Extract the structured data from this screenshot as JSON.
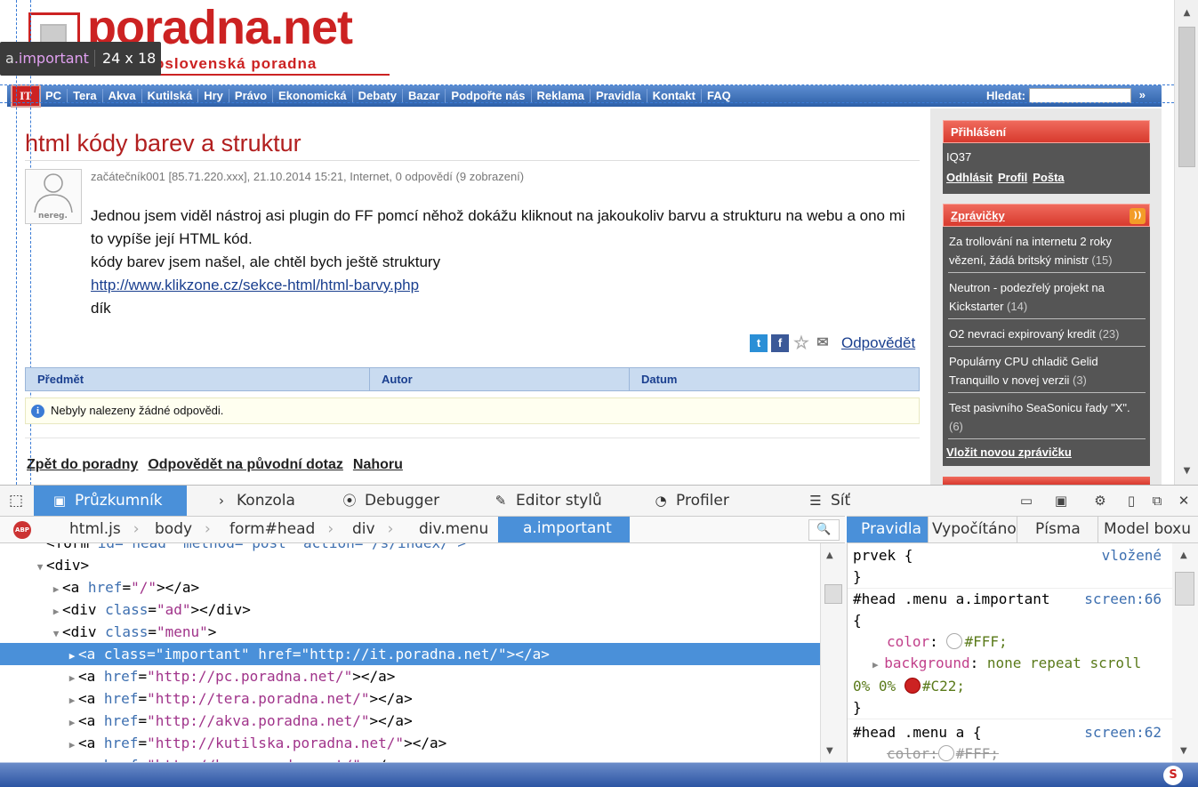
{
  "site": {
    "logo_text": "poradna.net",
    "logo_sub": "oslovenská poradna",
    "inspector_tooltip": {
      "selector_tag": "a",
      "selector_class": ".important",
      "dimensions": "24 x 18"
    }
  },
  "menu": {
    "it_label": "IT",
    "items": [
      "PC",
      "Tera",
      "Akva",
      "Kutilská",
      "Hry",
      "Právo",
      "Ekonomická",
      "Debaty",
      "Bazar",
      "Podpořte nás",
      "Reklama",
      "Pravidla",
      "Kontakt",
      "FAQ"
    ],
    "search_label": "Hledat:",
    "search_value": "",
    "search_go": "»"
  },
  "question": {
    "title": "html kódy barev a struktur",
    "avatar_label": "nereg.",
    "meta": "začátečník001 [85.71.220.xxx], 21.10.2014 15:21, Internet, 0 odpovědí (9 zobrazení)",
    "body_lines": [
      "Jednou jsem viděl nástroj asi plugin do FF pomcí něhož dokážu kliknout na jakoukoliv barvu a strukturu na webu a ono mi to vypíše její HTML kód.",
      "kódy barev jsem našel, ale chtěl bych ještě struktury"
    ],
    "link": "http://www.klikzone.cz/sekce-html/html-barvy.php",
    "thanks": "dík",
    "reply_link": "Odpovědět"
  },
  "replies_table": {
    "columns": [
      "Předmět",
      "Autor",
      "Datum"
    ],
    "empty_message": "Nebyly nalezeny žádné odpovědi."
  },
  "bottom_links": [
    "Zpět do poradny",
    "Odpovědět na původní dotaz",
    "Nahoru"
  ],
  "sidebar": {
    "login": {
      "title": "Přihlášení",
      "user": "IQ37",
      "links": [
        "Odhlásit",
        "Profil",
        "Pošta"
      ]
    },
    "news": {
      "title": "Zprávičky",
      "items": [
        {
          "text": "Za trollování na internetu 2 roky vězení, žádá britský ministr",
          "count": "(15)"
        },
        {
          "text": "Neutron - podezřelý projekt na Kickstarter",
          "count": "(14)"
        },
        {
          "text": "O2 nevraci expirovaný kredit",
          "count": "(23)"
        },
        {
          "text": "Populárny CPU chladič Gelid Tranquillo v novej verzii",
          "count": "(3)"
        },
        {
          "text": "Test pasivního SeaSonicu řady \"X\".",
          "count": "(6)"
        }
      ],
      "add_link": "Vložit novou zprávičku"
    }
  },
  "devtools": {
    "tabs": [
      "Průzkumník",
      "Konzola",
      "Debugger",
      "Editor stylů",
      "Profiler",
      "Síť"
    ],
    "active_tab": "Průzkumník",
    "breadcrumbs": [
      "html.js",
      "body",
      "form#head",
      "div",
      "div.menu",
      "a.important"
    ],
    "markup_lines": [
      {
        "indent": 3,
        "open": "<form ",
        "rest": "id=\"head\" method=\"post\" action=\"/s/index/\">",
        "twisty": ""
      },
      {
        "indent": 3,
        "twisty": "▼",
        "html": "<div>"
      },
      {
        "indent": 4,
        "twisty": "▶",
        "tag": "a",
        "attrs": [
          [
            "href",
            "/"
          ]
        ]
      },
      {
        "indent": 4,
        "twisty": "▶",
        "tag": "div",
        "attrs": [
          [
            "class",
            "ad"
          ]
        ]
      },
      {
        "indent": 4,
        "twisty": "▼",
        "tag": "div",
        "attrs": [
          [
            "class",
            "menu"
          ]
        ],
        "open_only": true
      },
      {
        "indent": 5,
        "twisty": "▶",
        "tag": "a",
        "attrs": [
          [
            "class",
            "important"
          ],
          [
            "href",
            "http://it.poradna.net/"
          ]
        ],
        "selected": true
      },
      {
        "indent": 5,
        "twisty": "▶",
        "tag": "a",
        "attrs": [
          [
            "href",
            "http://pc.poradna.net/"
          ]
        ]
      },
      {
        "indent": 5,
        "twisty": "▶",
        "tag": "a",
        "attrs": [
          [
            "href",
            "http://tera.poradna.net/"
          ]
        ]
      },
      {
        "indent": 5,
        "twisty": "▶",
        "tag": "a",
        "attrs": [
          [
            "href",
            "http://akva.poradna.net/"
          ]
        ]
      },
      {
        "indent": 5,
        "twisty": "▶",
        "tag": "a",
        "attrs": [
          [
            "href",
            "http://kutilska.poradna.net/"
          ]
        ]
      },
      {
        "indent": 5,
        "twisty": "▶",
        "tag": "a",
        "attrs": [
          [
            "href",
            "http://hry.poradna.net/"
          ]
        ]
      }
    ],
    "side_tabs": [
      "Pravidla",
      "Vypočítáno",
      "Písma",
      "Model boxu"
    ],
    "rules": {
      "element_selector": "prvek {",
      "element_source": "vložené",
      "rule1_selector": "#head .menu a.important",
      "rule1_source": "screen:66",
      "color_prop": "color",
      "color_value": "#FFF;",
      "bg_prop": "background",
      "bg_value": "none repeat scroll",
      "bg_value2": "0% 0%",
      "bg_color": "#C22;",
      "rule2_selector": "#head .menu a {",
      "rule2_source": "screen:62",
      "rule2_color": "color:",
      "rule2_color_value": "#FFF;",
      "swatch_white": "#FFFFFF",
      "swatch_red": "#CC2222"
    }
  }
}
